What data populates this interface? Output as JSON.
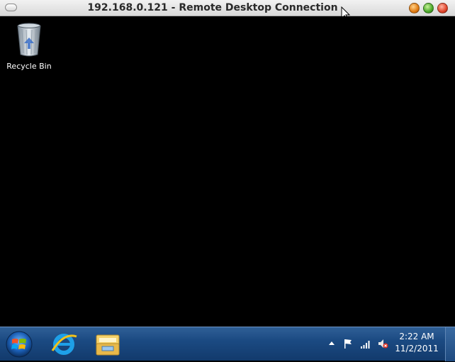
{
  "window": {
    "title": "192.168.0.121 - Remote Desktop Connection"
  },
  "desktop": {
    "icons": [
      {
        "label": "Recycle Bin",
        "icon": "recycle-bin-icon"
      }
    ]
  },
  "taskbar": {
    "start": {
      "icon": "windows-start-icon"
    },
    "apps": [
      {
        "icon": "internet-explorer-icon"
      },
      {
        "icon": "file-explorer-icon"
      }
    ],
    "tray": {
      "icons": [
        "show-hidden-icons-arrow",
        "action-center-flag-icon",
        "network-signal-icon",
        "volume-muted-icon"
      ],
      "time": "2:22 AM",
      "date": "11/2/2011"
    }
  },
  "colors": {
    "taskbar": "#1b4a82",
    "desktop": "#000000",
    "titlebar": "#e2e2e2"
  }
}
